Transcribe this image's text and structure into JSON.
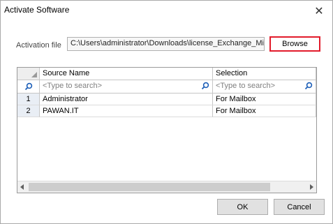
{
  "window": {
    "title": "Activate Software"
  },
  "activation": {
    "label": "Activation file",
    "path": "C:\\Users\\administrator\\Downloads\\license_Exchange_Mig",
    "browse_label": "Browse"
  },
  "grid": {
    "headers": [
      "Source Name",
      "Selection"
    ],
    "search_placeholder": "<Type to search>",
    "rows": [
      {
        "num": "1",
        "source": "Administrator",
        "selection": "For Mailbox"
      },
      {
        "num": "2",
        "source": "PAWAN.IT",
        "selection": "For Mailbox"
      }
    ]
  },
  "buttons": {
    "ok": "OK",
    "cancel": "Cancel"
  },
  "colors": {
    "browse_highlight": "#e21b2b",
    "search_icon": "#1d5fb8"
  },
  "icons": {
    "close": "close-icon",
    "search": "search-icon"
  }
}
